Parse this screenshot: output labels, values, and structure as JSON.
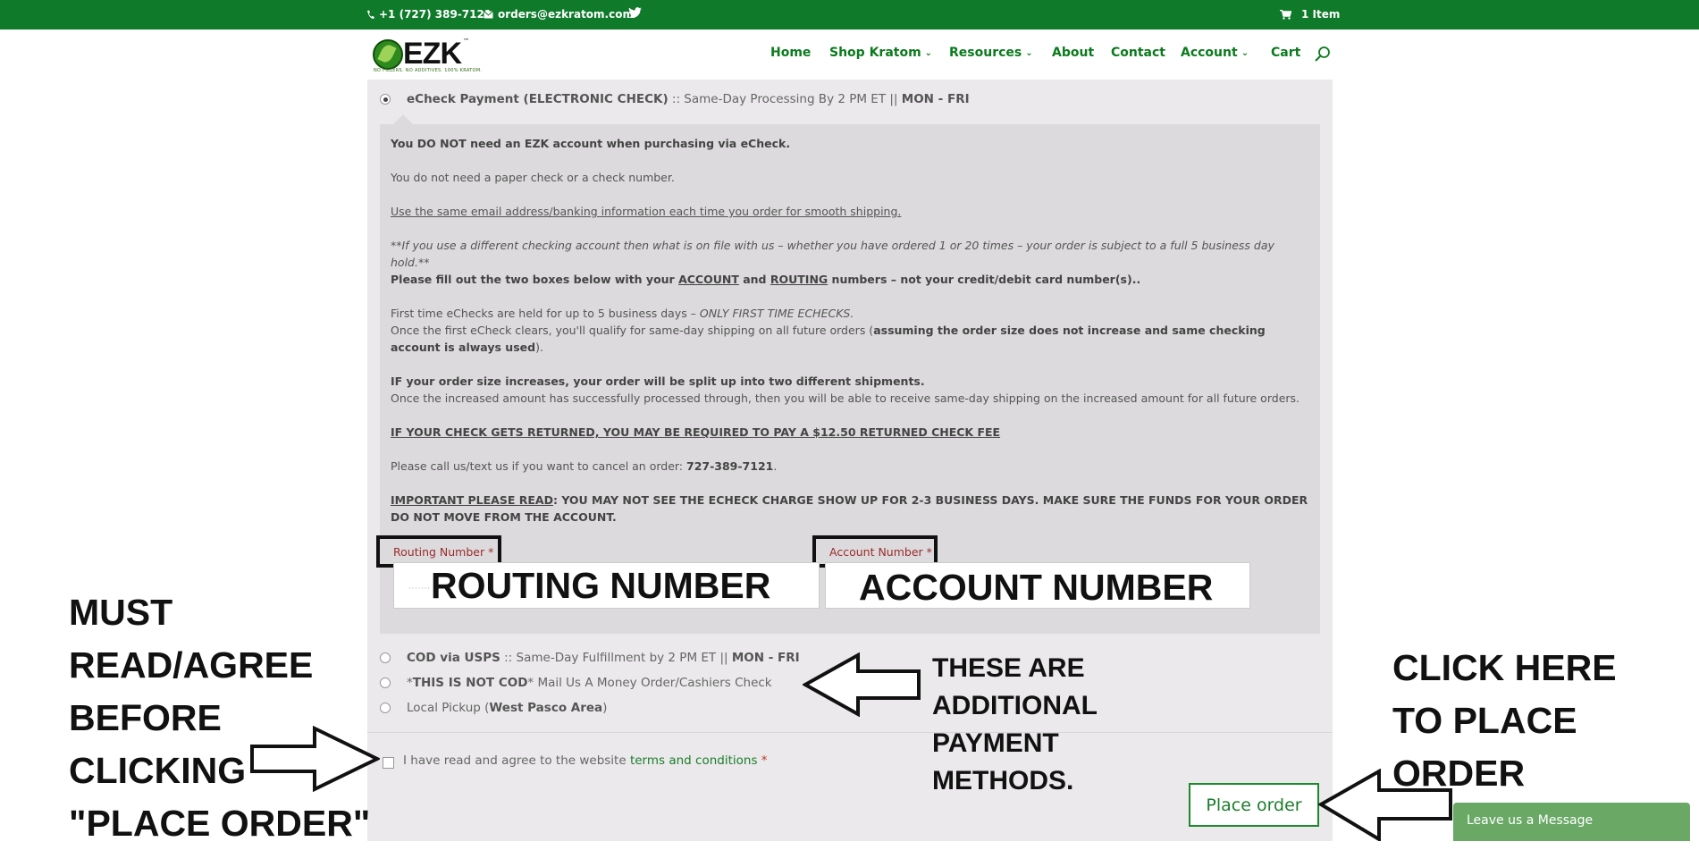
{
  "topbar": {
    "phone": "+1 (727) 389-7121",
    "email": "orders@ezkratom.com",
    "cart": "1 Item"
  },
  "header": {
    "logo": "EZK",
    "logo_tm": "™",
    "logo_tag": "NO FILLERS. NO ADDITIVES. 100% KRATOM.",
    "nav": [
      "Home",
      "Shop Kratom",
      "Resources",
      "About",
      "Contact",
      "Account",
      "Cart"
    ]
  },
  "payment": {
    "echeck_title": "eCheck Payment (ELECTRONIC CHECK)",
    "echeck_sub": " :: Same-Day Processing By 2 PM ET || ",
    "echeck_days": "MON - FRI",
    "notes": {
      "n1": "You DO NOT need an EZK account when purchasing via eCheck.",
      "n2": "You do not need a paper check or a check number.",
      "n3": "Use the same email address/banking information each time you order for smooth shipping.",
      "n4": "**If you use a different checking account then what is on file with us – whether you have ordered 1 or 20 times – your order is subject to a full 5 business day hold.**",
      "n5a": "Please fill out the two boxes below with your ",
      "n5b": "ACCOUNT",
      "n5c": " and ",
      "n5d": "ROUTING",
      "n5e": " numbers – not your credit/debit card number(s)..",
      "n6a": "First time eChecks are held for up to 5 business days – ",
      "n6b": "ONLY FIRST TIME ECHECKS.",
      "n6c": "Once the first eCheck clears, you'll qualify for same-day shipping on all future orders (",
      "n6d": "assuming the order size does not increase and same checking account is always used",
      "n6e": ").",
      "n7a": "IF your order size increases, your order will be split up into two different shipments.",
      "n7b": "Once the increased amount has successfully processed through, then you will be able to receive same-day shipping on the increased amount for all future orders.",
      "n8": "IF YOUR CHECK GETS RETURNED, YOU MAY BE REQUIRED TO PAY A $12.50 RETURNED CHECK FEE",
      "n9a": "Please call us/text us if you want to cancel an order: ",
      "n9b": "727-389-7121",
      "n9c": ".",
      "n10a": "IMPORTANT PLEASE READ",
      "n10b": ": YOU MAY NOT SEE THE ECHECK CHARGE SHOW UP FOR 2-3 BUSINESS DAYS. MAKE SURE THE FUNDS FOR YOUR ORDER DO NOT MOVE FROM THE ACCOUNT."
    },
    "routing_label": "Routing Number",
    "account_label": "Account Number",
    "required": "*",
    "routing_placeholder": "·······",
    "routing_overlay": "ROUTING NUMBER",
    "account_overlay": "ACCOUNT NUMBER",
    "cod_title": "COD via USPS",
    "cod_sub": " :: Same-Day Fulfillment by 2 PM ET || ",
    "cod_days": "MON - FRI",
    "mo_a": "*",
    "mo_b": "THIS IS NOT COD",
    "mo_c": "* Mail Us A Money Order/Cashiers Check",
    "pickup_a": "Local Pickup (",
    "pickup_b": "West Pasco Area",
    "pickup_c": ")"
  },
  "terms": {
    "text": "I have read and agree to the website ",
    "link": "terms and conditions",
    "required": "*"
  },
  "place_order": "Place order",
  "annotations": {
    "left": [
      "MUST",
      "READ/AGREE",
      "BEFORE",
      "CLICKING",
      "\"PLACE ORDER\""
    ],
    "middle": [
      "THESE ARE",
      "ADDITIONAL",
      "PAYMENT",
      "METHODS."
    ],
    "right": [
      "CLICK HERE",
      "TO PLACE",
      "ORDER"
    ]
  },
  "chat": "Leave us a Message",
  "colors": {
    "topbar": "#0e7a2a",
    "nav": "#0b7a1d",
    "required": "#9b2c2c",
    "chat": "#6aa866"
  }
}
